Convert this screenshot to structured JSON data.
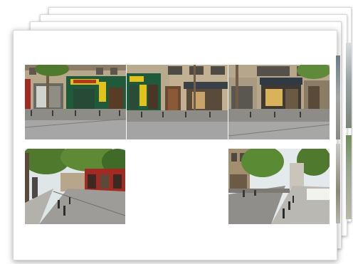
{
  "document": {
    "type": "stacked photo contact sheets",
    "sheet_count": 4,
    "photo_count_front_sheet": 5
  },
  "photos": [
    {
      "scene": "street-shopfronts-green-red"
    },
    {
      "scene": "street-shopfronts-green-brown"
    },
    {
      "scene": "street-shopfronts-corner-cafe"
    },
    {
      "scene": "street-trees-red-facade"
    },
    {
      "scene": "street-trees-sidewalk-perspective"
    }
  ],
  "colors": {
    "sheet": "#ffffff",
    "sky": "#cfd8dc",
    "building_beige": "#b9a98e",
    "shopfront_green": "#1f5a3a",
    "shopfront_red": "#a32a22",
    "sign_yellow": "#e3c21a",
    "pavement": "#9a9a98",
    "tree_green": "#4f7a2e"
  }
}
